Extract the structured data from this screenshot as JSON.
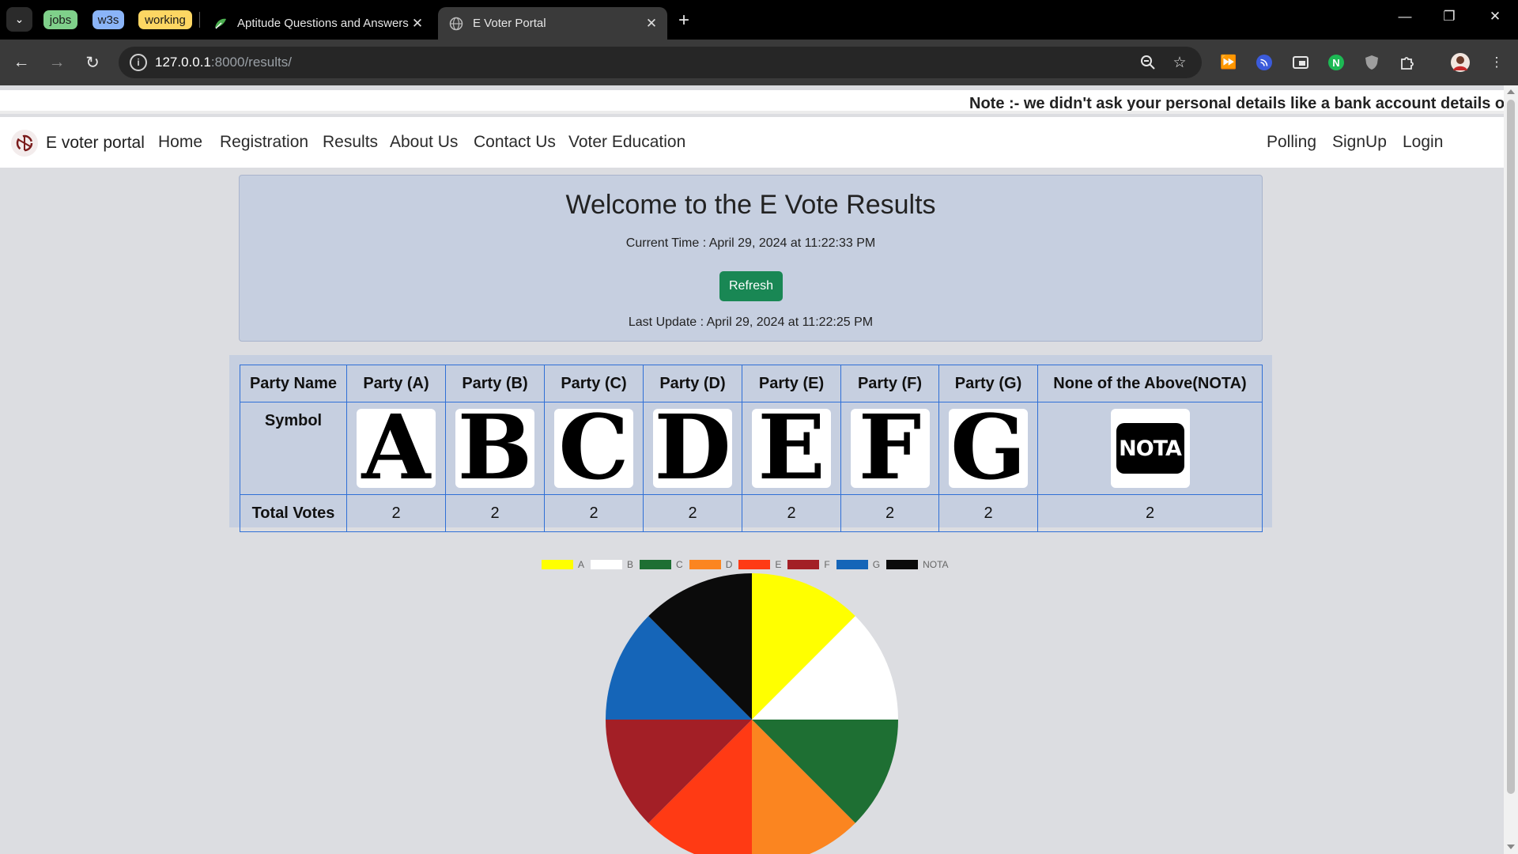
{
  "browser": {
    "tab_groups": [
      {
        "label": "jobs",
        "color": "#7fd08a"
      },
      {
        "label": "w3s",
        "color": "#8ab4f8"
      },
      {
        "label": "working",
        "color": "#fdd663"
      }
    ],
    "tabs": [
      {
        "title": "Aptitude Questions and Answers",
        "active": false
      },
      {
        "title": "E Voter Portal",
        "active": true
      }
    ],
    "url_host": "127.0.0.1",
    "url_path": ":8000/results/"
  },
  "marquee": "Note :- we didn't ask your personal details like a bank account details or",
  "nav": {
    "brand": "E voter portal",
    "links_left": [
      "Home",
      "Registration",
      "Results",
      "About Us",
      "Contact Us",
      "Voter Education"
    ],
    "links_right": [
      "Polling",
      "SignUp",
      "Login"
    ]
  },
  "results": {
    "title": "Welcome to the E Vote Results",
    "current_time": "Current Time : April 29, 2024 at 11:22:33 PM",
    "refresh_label": "Refresh",
    "last_update": "Last Update : April 29, 2024 at 11:22:25 PM"
  },
  "table": {
    "row_headers": [
      "Party Name",
      "Symbol",
      "Total Votes"
    ],
    "parties": [
      {
        "name": "Party (A)",
        "symbol": "A",
        "votes": "2"
      },
      {
        "name": "Party (B)",
        "symbol": "B",
        "votes": "2"
      },
      {
        "name": "Party (C)",
        "symbol": "C",
        "votes": "2"
      },
      {
        "name": "Party (D)",
        "symbol": "D",
        "votes": "2"
      },
      {
        "name": "Party (E)",
        "symbol": "E",
        "votes": "2"
      },
      {
        "name": "Party (F)",
        "symbol": "F",
        "votes": "2"
      },
      {
        "name": "Party (G)",
        "symbol": "G",
        "votes": "2"
      },
      {
        "name": "None of the Above(NOTA)",
        "symbol": "NOTA",
        "votes": "2"
      }
    ]
  },
  "chart_data": {
    "type": "pie",
    "categories": [
      "A",
      "B",
      "C",
      "D",
      "E",
      "F",
      "G",
      "NOTA"
    ],
    "values": [
      2,
      2,
      2,
      2,
      2,
      2,
      2,
      2
    ],
    "colors": [
      "#ffff00",
      "#ffffff",
      "#1e6f33",
      "#fb8520",
      "#ff3a14",
      "#a31f26",
      "#1565b8",
      "#0b0b0b"
    ],
    "legend": "top-center"
  }
}
